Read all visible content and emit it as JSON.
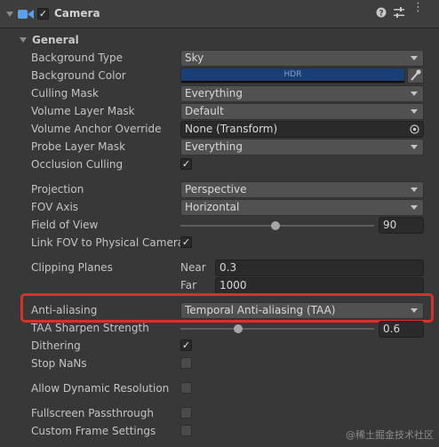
{
  "component": {
    "title": "Camera",
    "enabled": true,
    "icons": [
      "help-icon",
      "presets-icon",
      "more-icon"
    ]
  },
  "section": {
    "title": "General"
  },
  "rows": {
    "background_type": {
      "label": "Background Type",
      "value": "Sky"
    },
    "background_color": {
      "label": "Background Color",
      "swatch_text": "HDR",
      "color": "#1a3f76"
    },
    "culling_mask": {
      "label": "Culling Mask",
      "value": "Everything"
    },
    "volume_layer_mask": {
      "label": "Volume Layer Mask",
      "value": "Default"
    },
    "volume_anchor_override": {
      "label": "Volume Anchor Override",
      "value": "None (Transform)"
    },
    "probe_layer_mask": {
      "label": "Probe Layer Mask",
      "value": "Everything"
    },
    "occlusion_culling": {
      "label": "Occlusion Culling",
      "checked": true
    },
    "projection": {
      "label": "Projection",
      "value": "Perspective"
    },
    "fov_axis": {
      "label": "FOV Axis",
      "value": "Horizontal"
    },
    "field_of_view": {
      "label": "Field of View",
      "value": "90",
      "slider_fraction": 0.49
    },
    "link_fov": {
      "label": "Link FOV to Physical Camera",
      "checked": true
    },
    "clipping_planes": {
      "label": "Clipping Planes",
      "near_label": "Near",
      "near_value": "0.3",
      "far_label": "Far",
      "far_value": "1000"
    },
    "anti_aliasing": {
      "label": "Anti-aliasing",
      "value": "Temporal Anti-aliasing (TAA)"
    },
    "taa_sharpen": {
      "label": "TAA Sharpen Strength",
      "value": "0.6",
      "slider_fraction": 0.3
    },
    "dithering": {
      "label": "Dithering",
      "checked": true
    },
    "stop_nans": {
      "label": "Stop NaNs",
      "checked": false
    },
    "allow_dynamic_resolution": {
      "label": "Allow Dynamic Resolution",
      "checked": false
    },
    "fullscreen_passthrough": {
      "label": "Fullscreen Passthrough",
      "checked": false
    },
    "custom_frame_settings": {
      "label": "Custom Frame Settings",
      "checked": false
    }
  },
  "watermark": "@稀土掘金技术社区",
  "colors": {
    "highlight": "#d9302c",
    "panel_bg": "#383838"
  }
}
